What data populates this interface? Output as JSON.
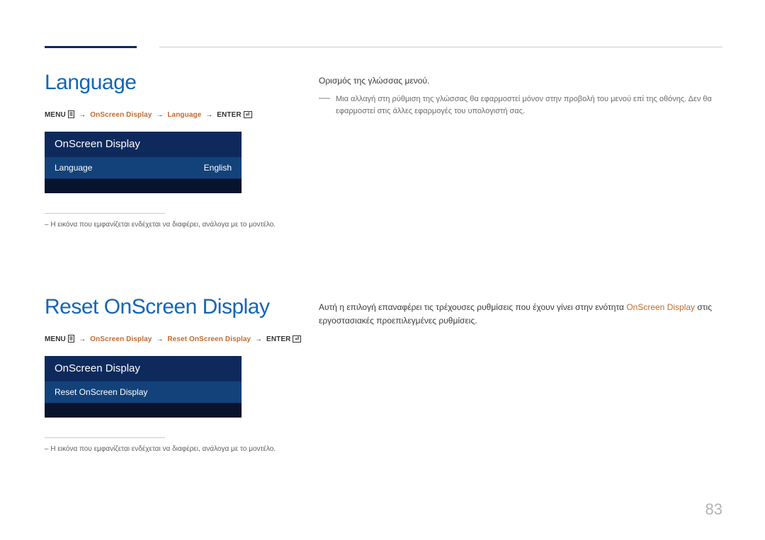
{
  "section1": {
    "title": "Language",
    "breadcrumb": {
      "menu": "MENU",
      "step1": "OnScreen Display",
      "step2": "Language",
      "enter": "ENTER"
    },
    "osd": {
      "header": "OnScreen Display",
      "rowLabel": "Language",
      "rowValue": "English"
    },
    "footnote": "– Η εικόνα που εμφανίζεται ενδέχεται να διαφέρει, ανάλογα με το μοντέλο."
  },
  "right1": {
    "desc": "Ορισμός της γλώσσας μενού.",
    "tip": "Μια αλλαγή στη ρύθμιση της γλώσσας θα εφαρμοστεί μόνον στην προβολή του μενού επί της οθόνης. Δεν θα εφαρμοστεί στις άλλες εφαρμογές του υπολογιστή σας."
  },
  "section2": {
    "title": "Reset OnScreen Display",
    "breadcrumb": {
      "menu": "MENU",
      "step1": "OnScreen Display",
      "step2": "Reset OnScreen Display",
      "enter": "ENTER"
    },
    "osd": {
      "header": "OnScreen Display",
      "rowLabel": "Reset OnScreen Display"
    },
    "footnote": "– Η εικόνα που εμφανίζεται ενδέχεται να διαφέρει, ανάλογα με το μοντέλο."
  },
  "right2": {
    "pre": "Αυτή η επιλογή επαναφέρει τις τρέχουσες ρυθμίσεις που έχουν γίνει στην ενότητα ",
    "highlight": "OnScreen Display",
    "post": " στις εργοστασιακές προεπιλεγμένες ρυθμίσεις."
  },
  "pageNumber": "83",
  "icons": {
    "menu": "Ⅲ",
    "enter": "⏎"
  }
}
